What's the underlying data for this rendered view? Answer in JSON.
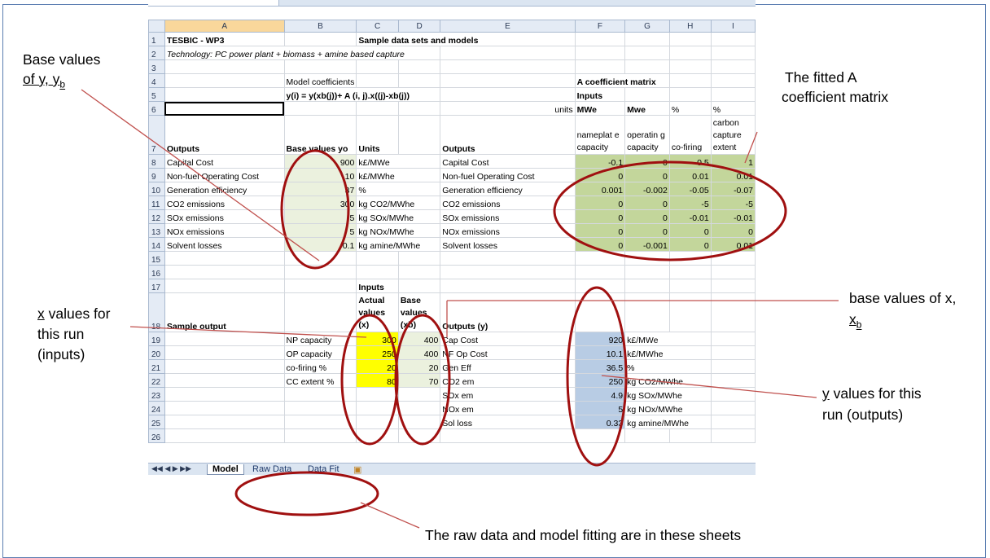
{
  "columns": [
    "A",
    "B",
    "C",
    "D",
    "E",
    "F",
    "G",
    "H",
    "I"
  ],
  "rows": {
    "r1": {
      "A": "TESBIC - WP3",
      "C": "Sample data sets and models"
    },
    "r2": {
      "A": "Technology: PC power plant + biomass + amine based capture"
    },
    "r4": {
      "B": "Model coefficients",
      "F": "A coefficient matrix"
    },
    "r5": {
      "B": "y(i) = y(xb(j))+ A (i, j).x((j)-xb(j))",
      "F": "Inputs"
    },
    "r6": {
      "E": "units",
      "F": "MWe",
      "G": "Mwe",
      "H": "%",
      "I": "%"
    },
    "r7": {
      "A": "Outputs",
      "B": "Base values yo",
      "C": "Units",
      "E": "Outputs",
      "F": "nameplat e capacity",
      "G": "operatin g capacity",
      "H": "co-firing",
      "I": "carbon capture extent"
    }
  },
  "outputs_table": [
    {
      "row": "8",
      "name": "Capital Cost",
      "base": "900",
      "unit": "k£/MWe",
      "out": "Capital Cost",
      "a": [
        "-0.1",
        "0",
        "0.5",
        "1"
      ]
    },
    {
      "row": "9",
      "name": "Non-fuel Operating Cost",
      "base": "10",
      "unit": "k£/MWhe",
      "out": "Non-fuel Operating Cost",
      "a": [
        "0",
        "0",
        "0.01",
        "0.01"
      ]
    },
    {
      "row": "10",
      "name": "Generation efficiency",
      "base": "37",
      "unit": "%",
      "out": "Generation efficiency",
      "a": [
        "0.001",
        "-0.002",
        "-0.05",
        "-0.07"
      ]
    },
    {
      "row": "11",
      "name": "CO2 emissions",
      "base": "300",
      "unit": "kg CO2/MWhe",
      "out": "CO2 emissions",
      "a": [
        "0",
        "0",
        "-5",
        "-5"
      ]
    },
    {
      "row": "12",
      "name": "SOx emissions",
      "base": "5",
      "unit": "kg SOx/MWhe",
      "out": "SOx emissions",
      "a": [
        "0",
        "0",
        "-0.01",
        "-0.01"
      ]
    },
    {
      "row": "13",
      "name": "NOx emissions",
      "base": "5",
      "unit": "kg NOx/MWhe",
      "out": "NOx emissions",
      "a": [
        "0",
        "0",
        "0",
        "0"
      ]
    },
    {
      "row": "14",
      "name": "Solvent losses",
      "base": "0.1",
      "unit": "kg amine/MWhe",
      "out": "Solvent losses",
      "a": [
        "0",
        "-0.001",
        "0",
        "0.01"
      ]
    }
  ],
  "r17": {
    "C": "Inputs"
  },
  "r18": {
    "A": "Sample output",
    "C": "Actual values (x)",
    "D": "Base values (xb)",
    "E": "Outputs (y)"
  },
  "run_table": [
    {
      "row": "19",
      "input": "NP capacity",
      "x": "300",
      "xb": "400",
      "out": "Cap Cost",
      "y": "920",
      "unit": "k£/MWe"
    },
    {
      "row": "20",
      "input": "OP capacity",
      "x": "250",
      "xb": "400",
      "out": "NF Op Cost",
      "y": "10.1",
      "unit": "k£/MWhe"
    },
    {
      "row": "21",
      "input": "co-firing %",
      "x": "20",
      "xb": "20",
      "out": "Gen Eff",
      "y": "36.5",
      "unit": "%"
    },
    {
      "row": "22",
      "input": "CC extent %",
      "x": "80",
      "xb": "70",
      "out": "CO2 em",
      "y": "250",
      "unit": "kg CO2/MWhe"
    },
    {
      "row": "23",
      "input": "",
      "x": "",
      "xb": "",
      "out": "SOx em",
      "y": "4.9",
      "unit": "kg SOx/MWhe"
    },
    {
      "row": "24",
      "input": "",
      "x": "",
      "xb": "",
      "out": "NOx em",
      "y": "5",
      "unit": "kg NOx/MWhe"
    },
    {
      "row": "25",
      "input": "",
      "x": "",
      "xb": "",
      "out": "Sol loss",
      "y": "0.33",
      "unit": "kg amine/MWhe"
    }
  ],
  "tabs": {
    "model": "Model",
    "raw": "Raw Data",
    "fit": "Data Fit"
  },
  "annotations": {
    "base_values_title": "Base values",
    "base_values_of": "of y, y",
    "base_values_sub": "b",
    "fitted_line1": "The fitted A",
    "fitted_line2": "coefficient matrix",
    "x_values_line1_u": "x",
    "x_values_line1_rest": " values for",
    "x_values_line2": "this run",
    "x_values_line3": "(inputs)",
    "base_x_line1": "base values of x,",
    "base_x_line2": "x",
    "base_x_sub": "b",
    "y_values_line1_u": "y",
    "y_values_line1_rest": " values for this",
    "y_values_line2": "run (outputs)",
    "raw_data_note": "The raw data and model fitting are in these sheets"
  },
  "colors": {
    "oval": "#a01010",
    "line": "#c0504d",
    "green_light": "#ebf1de",
    "green_dark": "#c3d69b",
    "yellow": "#ffff00",
    "blue": "#b8cce4"
  }
}
